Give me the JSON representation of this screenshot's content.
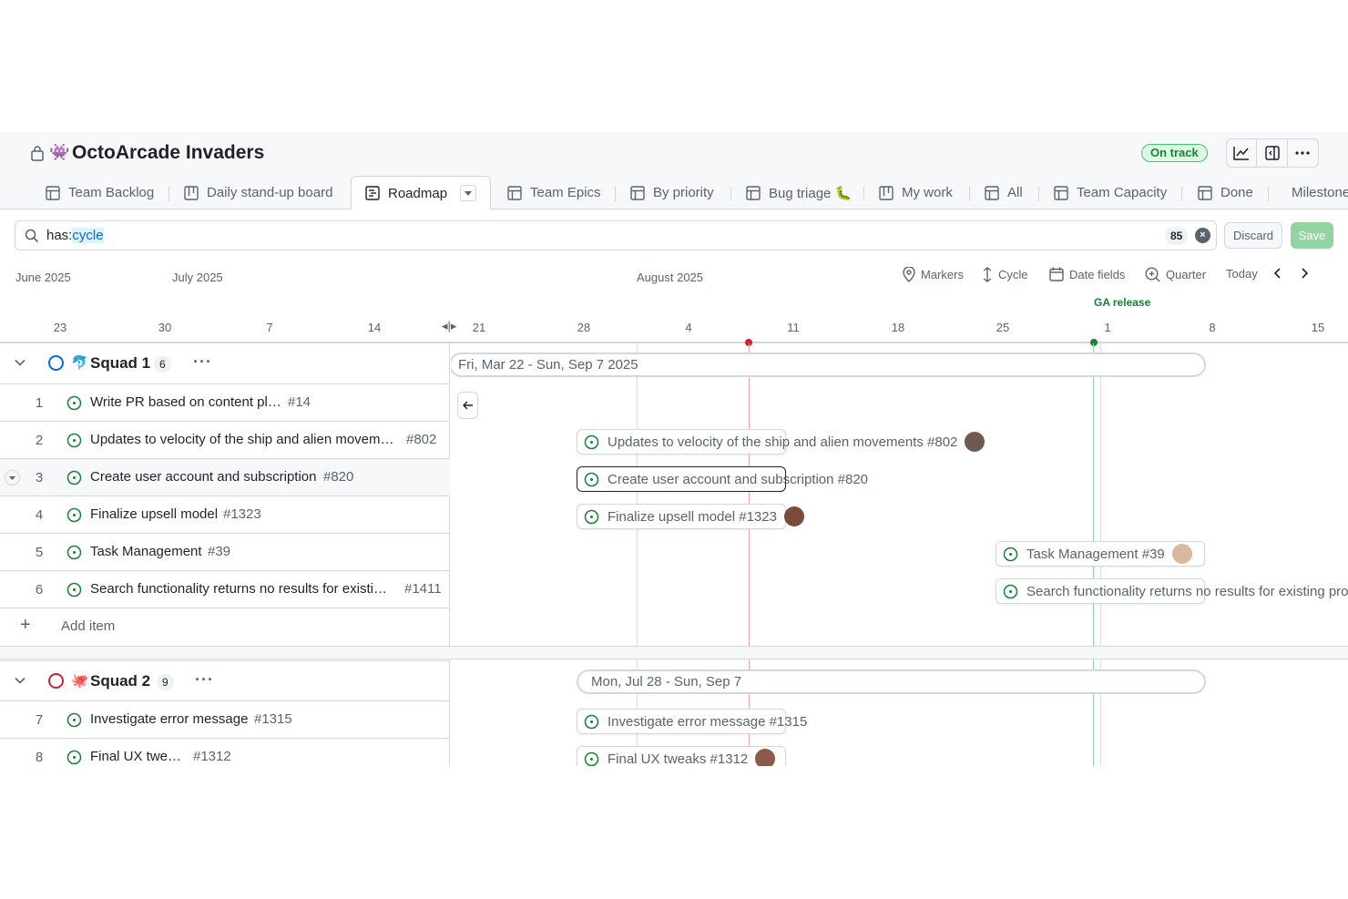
{
  "project": {
    "title": "OctoArcade Invaders",
    "emoji": "👾",
    "status": "On track",
    "status_color": "#1a7f37"
  },
  "header_buttons": [
    "insights-icon",
    "side-panel-icon",
    "kebab-menu-icon"
  ],
  "tabs": [
    {
      "label": "Team Backlog",
      "icon": "table-icon"
    },
    {
      "label": "Daily stand-up board",
      "icon": "board-icon"
    },
    {
      "label": "Roadmap",
      "icon": "roadmap-icon",
      "active": true
    },
    {
      "label": "Team Epics",
      "icon": "table-icon"
    },
    {
      "label": "By priority",
      "icon": "table-icon"
    },
    {
      "label": "Bug triage 🐛",
      "icon": "table-icon"
    },
    {
      "label": "My work",
      "icon": "board-icon"
    },
    {
      "label": "All",
      "icon": "table-icon"
    },
    {
      "label": "Team Capacity",
      "icon": "table-icon"
    },
    {
      "label": "Done",
      "icon": "table-icon"
    },
    {
      "label": "Milestone",
      "icon": "table-icon"
    }
  ],
  "filter": {
    "prefix": "has:",
    "keyword": "cycle",
    "count": "85",
    "discard_label": "Discard",
    "save_label": "Save"
  },
  "timeline": {
    "months": [
      "June 2025",
      "July 2025",
      "August 2025"
    ],
    "controls": {
      "markers": "Markers",
      "cycle": "Cycle",
      "date_fields": "Date fields",
      "zoom": "Quarter",
      "today": "Today"
    },
    "days": [
      "23",
      "30",
      "7",
      "14",
      "21",
      "28",
      "4",
      "11",
      "18",
      "25",
      "1",
      "8",
      "15"
    ],
    "marker_label": "GA release",
    "today_color": "#cf222e",
    "marker_color": "#1a7f37"
  },
  "groups": [
    {
      "name": "Squad 1",
      "emoji": "🐬",
      "count": "6",
      "color": "#0969da",
      "range": "Fri, Mar 22 - Sun, Sep 7 2025",
      "items": [
        {
          "num": "1",
          "title": "Write PR based on content plan",
          "ref": "#14"
        },
        {
          "num": "2",
          "title": "Updates to velocity of the ship and alien moveme…",
          "ref": "#802",
          "bar": "Updates to velocity of the ship and alien movements #802"
        },
        {
          "num": "3",
          "title": "Create user account and subscription",
          "ref": "#820",
          "bar": "Create user account and subscription #820"
        },
        {
          "num": "4",
          "title": "Finalize upsell model",
          "ref": "#1323",
          "bar": "Finalize upsell model #1323"
        },
        {
          "num": "5",
          "title": "Task Management",
          "ref": "#39",
          "bar": "Task Management #39"
        },
        {
          "num": "6",
          "title": "Search functionality returns no results for existin…",
          "ref": "#1411",
          "bar": "Search functionality returns no results for existing pro"
        }
      ],
      "add_item": "Add item"
    },
    {
      "name": "Squad 2",
      "emoji": "🐙",
      "count": "9",
      "color": "#cf222e",
      "range": "Mon, Jul 28 - Sun, Sep 7",
      "items": [
        {
          "num": "7",
          "title": "Investigate error message",
          "ref": "#1315",
          "bar": "Investigate error message #1315"
        },
        {
          "num": "8",
          "title": "Final UX tweaks",
          "ref": "#1312",
          "bar": "Final UX tweaks #1312"
        }
      ]
    }
  ]
}
